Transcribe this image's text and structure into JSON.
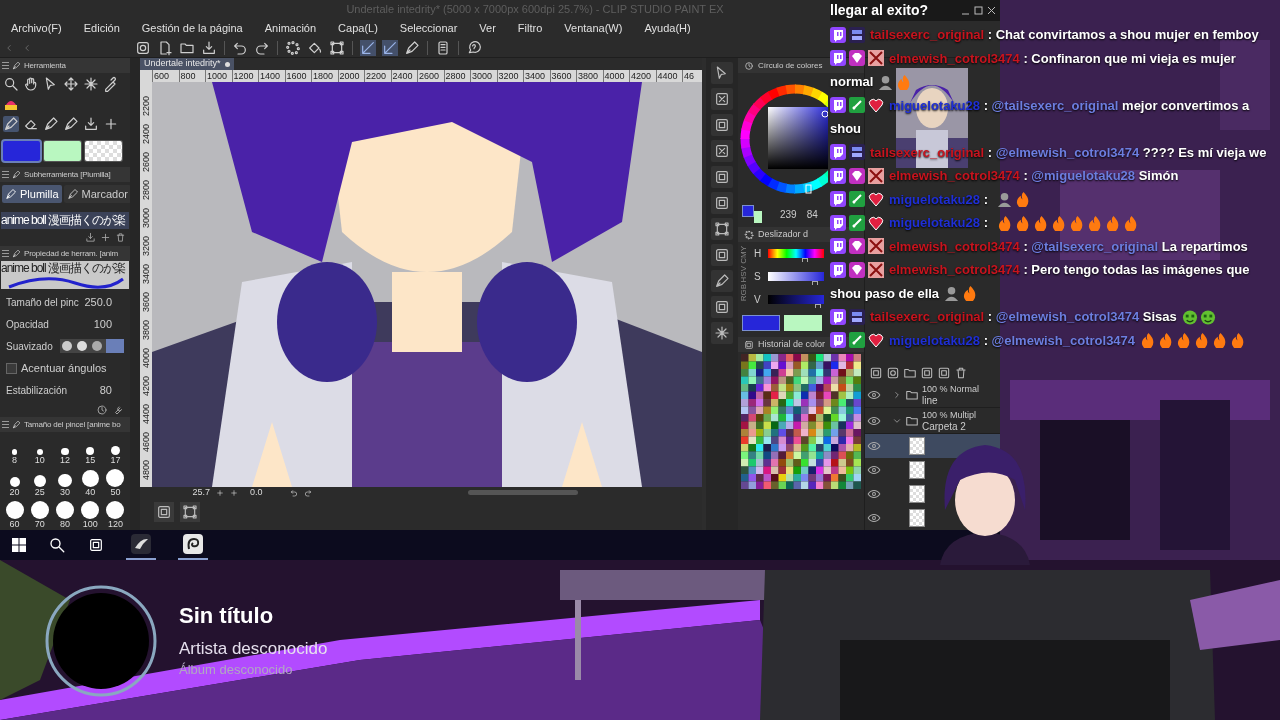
{
  "app_window": {
    "title": "Undertale intedrity* (5000 x 7000px 600dpi 25.7%) - CLIP STUDIO PAINT EX",
    "menu": [
      "Archivo(F)",
      "Edición",
      "Gestión de la página",
      "Animación",
      "Capa(L)",
      "Seleccionar",
      "Ver",
      "Filtro",
      "Ventana(W)",
      "Ayuda(H)"
    ],
    "document_tab": "Undertale intedrity*",
    "ruler_h": [
      "600",
      "800",
      "1000",
      "1200",
      "1400",
      "1600",
      "1800",
      "2000",
      "2200",
      "2400",
      "2600",
      "2800",
      "3000",
      "3200",
      "3400",
      "3600",
      "3800",
      "4000",
      "4200",
      "4400",
      "46"
    ],
    "ruler_v": [
      "2200",
      "2400",
      "2600",
      "2800",
      "3000",
      "3200",
      "3400",
      "3600",
      "3800",
      "4000",
      "4200",
      "4400",
      "4600",
      "4800"
    ],
    "tool_panel": {
      "title": "Herramienta",
      "swatches": [
        {
          "kind": "color",
          "color": "#2626d9",
          "selected": true
        },
        {
          "kind": "color",
          "color": "#b9f7c0",
          "selected": false
        },
        {
          "kind": "transparent",
          "selected": false
        }
      ]
    },
    "sub_tool_panel": {
      "title": "Subherramienta [Plumilla]",
      "tabs": [
        {
          "label": "Plumilla",
          "selected": true
        },
        {
          "label": "Marcador",
          "selected": false
        }
      ],
      "brush": "anime boll 漫画描くのが楽"
    },
    "tool_property": {
      "title": "Propiedad de herram. [anim",
      "preview": "anime boll 漫画描くのが楽",
      "settings": [
        {
          "kind": "value",
          "label": "Tamaño del pinc",
          "value": "250.0"
        },
        {
          "kind": "value",
          "label": "Opacidad",
          "value": "100"
        },
        {
          "kind": "smoothing",
          "label": "Suavizado"
        },
        {
          "kind": "checkbox",
          "label": "Acentuar ángulos",
          "checked": false
        },
        {
          "kind": "value",
          "label": "Estabilización",
          "value": "80"
        }
      ]
    },
    "brush_size": {
      "title": "Tamaño del pincel [anime bo",
      "sizes": [
        "8",
        "10",
        "12",
        "15",
        "17",
        "20",
        "25",
        "30",
        "40",
        "50",
        "60",
        "70",
        "80",
        "100",
        "120"
      ]
    },
    "navigator": {
      "zoom": "25.7",
      "angle": "0.0"
    },
    "color_wheel": {
      "title": "Círculo de colores",
      "h": "239",
      "s": "84"
    },
    "color_slider": {
      "title": "Deslizador d",
      "tabs": [
        "RGB",
        "HSV",
        "CMY"
      ],
      "channels": [
        {
          "label": "H",
          "level": 0.66
        },
        {
          "label": "S",
          "level": 0.84
        },
        {
          "label": "V",
          "level": 0.9
        }
      ]
    },
    "color_history": {
      "title": "Historial de color"
    },
    "layers": [
      {
        "blend": "100 % Normal",
        "name": "line",
        "expanded": false
      },
      {
        "blend": "100 % Multipl",
        "name": "Carpeta 2",
        "expanded": true
      }
    ]
  },
  "taskbar": {
    "apps": [
      {
        "kind": "feather",
        "active": true
      },
      {
        "kind": "spiral",
        "active": true
      }
    ]
  },
  "chat": {
    "title": "llegar al exito?",
    "messages": [
      {
        "user": "tailsexerc_original",
        "color": "#c8141e",
        "badges": [
          {
            "kind": "twitch"
          },
          {
            "kind": "year"
          }
        ],
        "separator": ":",
        "parts": [
          {
            "kind": "text",
            "text": "Chat convirtamos a shou mujer en femboy"
          }
        ]
      },
      {
        "user": "elmewish_cotrol3474",
        "color": "#c8141e",
        "badges": [
          {
            "kind": "twitch"
          },
          {
            "kind": "gem"
          },
          {
            "kind": "cross"
          }
        ],
        "separator": ":",
        "parts": [
          {
            "kind": "text",
            "text": "Confinaron que mi vieja es mujer"
          }
        ],
        "continuation": "normal",
        "emotes": [
          {
            "kind": "figure"
          },
          {
            "kind": "fire"
          }
        ]
      },
      {
        "user": "miguelotaku28",
        "color": "#1f2fd6",
        "badges": [
          {
            "kind": "twitch"
          },
          {
            "kind": "sword"
          },
          {
            "kind": "heart"
          }
        ],
        "separator": ":",
        "parts": [
          {
            "kind": "mention",
            "text": "@tailsexerc_original"
          },
          {
            "kind": "text",
            "text": "mejor convertimos a"
          }
        ],
        "continuation": "shou"
      },
      {
        "user": "tailsexerc_original",
        "color": "#c8141e",
        "badges": [
          {
            "kind": "twitch"
          },
          {
            "kind": "year"
          }
        ],
        "separator": ":",
        "parts": [
          {
            "kind": "mention",
            "text": "@elmewish_cotrol3474"
          },
          {
            "kind": "text",
            "text": "???? Es mí vieja we"
          }
        ]
      },
      {
        "user": "elmewish_cotrol3474",
        "color": "#c8141e",
        "badges": [
          {
            "kind": "twitch"
          },
          {
            "kind": "gem"
          },
          {
            "kind": "cross"
          }
        ],
        "separator": ":",
        "parts": [
          {
            "kind": "mention",
            "text": "@miguelotaku28"
          },
          {
            "kind": "text",
            "text": "Simón"
          }
        ]
      },
      {
        "user": "miguelotaku28",
        "color": "#1f2fd6",
        "badges": [
          {
            "kind": "twitch"
          },
          {
            "kind": "sword"
          },
          {
            "kind": "heart"
          }
        ],
        "separator": ":",
        "emotes": [
          {
            "kind": "figure"
          },
          {
            "kind": "fire"
          }
        ]
      },
      {
        "user": "miguelotaku28",
        "color": "#1f2fd6",
        "badges": [
          {
            "kind": "twitch"
          },
          {
            "kind": "sword"
          },
          {
            "kind": "heart"
          }
        ],
        "separator": ":",
        "emotes": [
          {
            "kind": "fire"
          },
          {
            "kind": "fire"
          },
          {
            "kind": "fire"
          },
          {
            "kind": "fire"
          },
          {
            "kind": "fire"
          },
          {
            "kind": "fire"
          },
          {
            "kind": "fire"
          },
          {
            "kind": "fire"
          }
        ]
      },
      {
        "user": "elmewish_cotrol3474",
        "color": "#c8141e",
        "badges": [
          {
            "kind": "twitch"
          },
          {
            "kind": "gem"
          },
          {
            "kind": "cross"
          }
        ],
        "separator": ":",
        "parts": [
          {
            "kind": "mention",
            "text": "@tailsexerc_original"
          },
          {
            "kind": "text",
            "text": "La repartimos"
          }
        ]
      },
      {
        "user": "elmewish_cotrol3474",
        "color": "#c8141e",
        "badges": [
          {
            "kind": "twitch"
          },
          {
            "kind": "gem"
          },
          {
            "kind": "cross"
          }
        ],
        "separator": ":",
        "parts": [
          {
            "kind": "text",
            "text": "Pero tengo todas las imágenes que"
          }
        ],
        "continuation": "shou paso de ella",
        "emotes": [
          {
            "kind": "figure"
          },
          {
            "kind": "fire"
          }
        ]
      },
      {
        "user": "tailsexerc_original",
        "color": "#c8141e",
        "badges": [
          {
            "kind": "twitch"
          },
          {
            "kind": "year"
          }
        ],
        "separator": ":",
        "parts": [
          {
            "kind": "mention",
            "text": "@elmewish_cotrol3474"
          },
          {
            "kind": "text",
            "text": "Sisas"
          }
        ],
        "emotes": [
          {
            "kind": "money"
          },
          {
            "kind": "money"
          }
        ]
      },
      {
        "user": "miguelotaku28",
        "color": "#1f2fd6",
        "badges": [
          {
            "kind": "twitch"
          },
          {
            "kind": "sword"
          },
          {
            "kind": "heart"
          }
        ],
        "separator": ":",
        "parts": [
          {
            "kind": "mention",
            "text": "@elmewish_cotrol3474"
          }
        ],
        "emotes": [
          {
            "kind": "fire"
          },
          {
            "kind": "fire"
          },
          {
            "kind": "fire"
          },
          {
            "kind": "fire"
          },
          {
            "kind": "fire"
          },
          {
            "kind": "fire"
          }
        ]
      }
    ]
  },
  "media": {
    "title": "Sin título",
    "artist": "Artista desconocido",
    "album": "Álbum desconocido"
  }
}
